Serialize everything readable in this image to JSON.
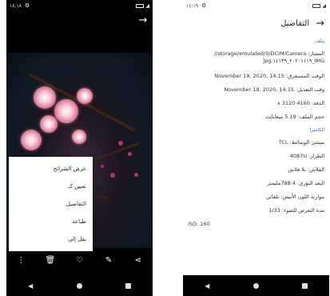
{
  "left": {
    "status": {
      "time": "١٤:١٨"
    },
    "menu_items": [
      "عرض الشرائح",
      "تعيين كـ",
      "التفاصيل",
      "طباعة",
      "نقل إلى"
    ]
  },
  "right": {
    "status": {
      "time": "١٤:١٩"
    },
    "header_title": "التفاصيل",
    "file_section": "ملف",
    "path": "المسار: storage/emulated/0/DCIM/Camera//‏IMG_٢٠٢٠١١١٩_١٤١٣٩.jpg",
    "taken": "الوقت المستغرق: November 19, 2020, 14:15",
    "modified": "وقت التعديل: November 19, 2020, 14:15",
    "resolution": "الدقة: 4160 x 3120",
    "size": "حجم الملف: 5.19 ميغابايت",
    "camera_section": "الكاميرا",
    "maker": "منشئ الوسائط: TCL",
    "model": "الطراز: 4087U",
    "flash": "الفلاش: بلا فلاش",
    "focal": "البعد البؤري: 788.4مليمتر",
    "wb": "موازنة اللون الأبيض: تلقائي",
    "exposure": "مدة التعرض للضوء: 1/33",
    "iso": "ISO: 160"
  }
}
